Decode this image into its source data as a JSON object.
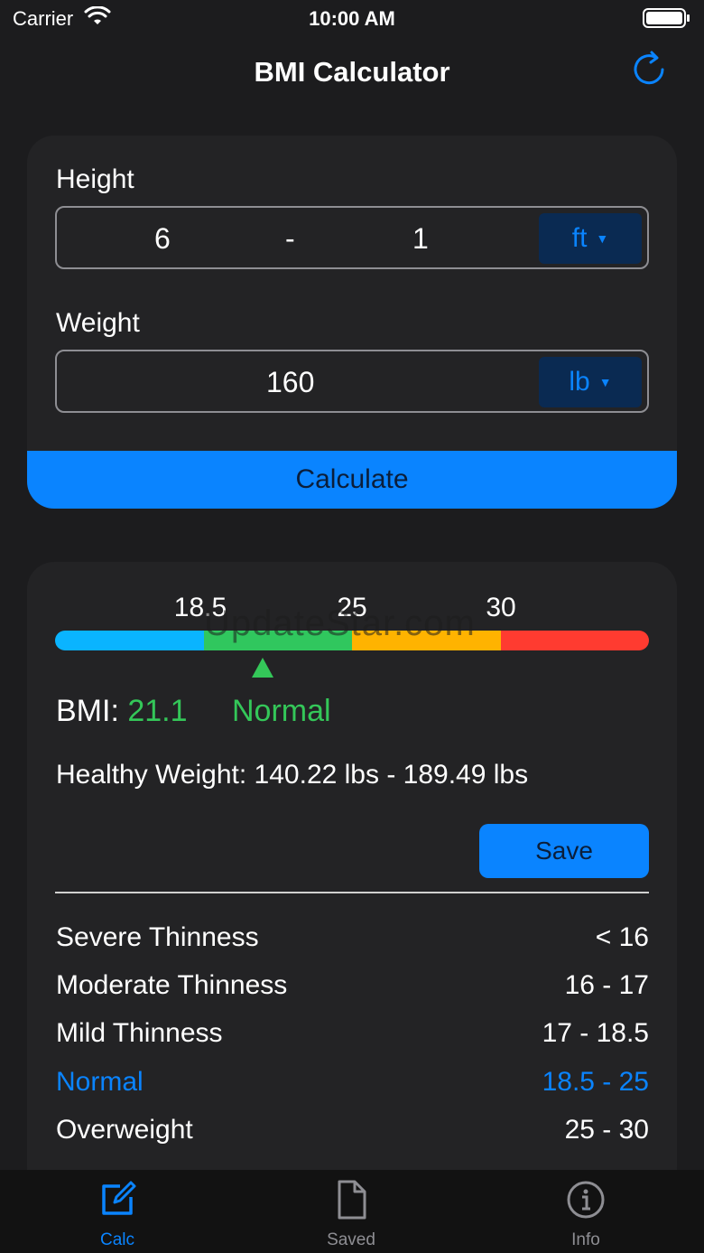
{
  "status": {
    "carrier": "Carrier",
    "time": "10:00 AM"
  },
  "nav": {
    "title": "BMI Calculator"
  },
  "height": {
    "label": "Height",
    "feet": "6",
    "separator": "-",
    "inches": "1",
    "unit": "ft"
  },
  "weight": {
    "label": "Weight",
    "value": "160",
    "unit": "lb"
  },
  "calculate_label": "Calculate",
  "scale": {
    "ticks": [
      "18.5",
      "25",
      "30"
    ],
    "watermark": "UpdateStar.com",
    "colors": {
      "underweight": "#0ab4ff",
      "normal": "#30c75e",
      "overweight": "#ffb300",
      "obese": "#ff3b30"
    }
  },
  "result": {
    "bmi_label": "BMI:",
    "bmi_value": "21.1",
    "status": "Normal",
    "healthy_weight": "Healthy Weight: 140.22 lbs - 189.49 lbs",
    "save_label": "Save"
  },
  "categories": [
    {
      "name": "Severe Thinness",
      "range": "< 16"
    },
    {
      "name": "Moderate Thinness",
      "range": "16 - 17"
    },
    {
      "name": "Mild Thinness",
      "range": "17 - 18.5"
    },
    {
      "name": "Normal",
      "range": "18.5 - 25"
    },
    {
      "name": "Overweight",
      "range": "25 - 30"
    }
  ],
  "tabs": [
    {
      "label": "Calc",
      "icon": "edit-icon"
    },
    {
      "label": "Saved",
      "icon": "document-icon"
    },
    {
      "label": "Info",
      "icon": "info-icon"
    }
  ],
  "accent": "#0a84ff"
}
